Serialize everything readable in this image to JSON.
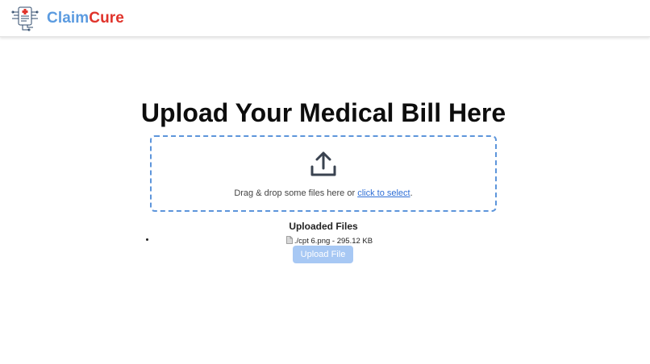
{
  "header": {
    "brand_part1": "Claim",
    "brand_part2": "Cure",
    "logo_icon": "medical-circuit-icon"
  },
  "main": {
    "title": "Upload Your Medical Bill Here",
    "dropzone": {
      "icon": "upload-icon",
      "text_before_link": "Drag & drop some files here or ",
      "link_text": "click to select",
      "text_after_link": "."
    },
    "uploaded_files": {
      "title": "Uploaded Files",
      "items": [
        {
          "icon": "file-icon",
          "name": "./cpt 6.png",
          "separator": " - ",
          "size": "295.12 KB"
        }
      ]
    },
    "upload_button_label": "Upload File"
  },
  "colors": {
    "brand_blue": "#5b9be0",
    "brand_red": "#e0332b",
    "dropzone_border": "#5d95db",
    "link": "#2f6fd6",
    "button_disabled": "#a7c8f4"
  }
}
